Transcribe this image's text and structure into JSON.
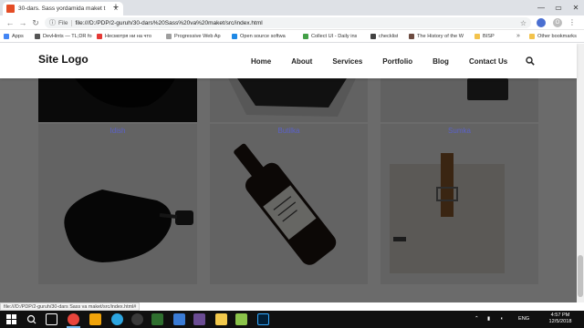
{
  "browser": {
    "tab_title": "30-dars. Sass yordamida maket t",
    "url_scheme_label": "File",
    "url": "file:///D:/PDP/2-guruh/30-dars%20Sass%20va%20maket/src/index.html",
    "status_url": "file:///D:/PDP/2-guruh/30-dars Sass va maket/src/index.html#",
    "profile_initial": "O"
  },
  "bookmarks": [
    {
      "label": "Apps",
      "color": "#4285f4"
    },
    {
      "label": "DevHints — TL;DR fo",
      "color": "#555555"
    },
    {
      "label": "Несмотря ни на что",
      "color": "#e53935"
    },
    {
      "label": "Progressive Web Ap",
      "color": "#9e9e9e"
    },
    {
      "label": "Open source softwa",
      "color": "#1e88e5"
    },
    {
      "label": "Collect UI - Daily ins",
      "color": "#43a047"
    },
    {
      "label": "checklist",
      "color": "#424242"
    },
    {
      "label": "The History of the W",
      "color": "#6d4c41"
    },
    {
      "label": "BISP",
      "color": "#f3c34c"
    }
  ],
  "bookmarks_other": "Other bookmarks",
  "site": {
    "logo": "Site Logo",
    "nav": [
      "Home",
      "About",
      "Services",
      "Portfolio",
      "Blog",
      "Contact Us"
    ]
  },
  "portfolio": {
    "captions": [
      "Idish",
      "Butilka",
      "Sumka"
    ]
  },
  "taskbar": {
    "lang": "ENG",
    "time": "4:57 PM",
    "date": "12/5/2018"
  },
  "colors": {
    "caption": "#5b62c8",
    "overlay": "rgba(0,0,0,0.58)"
  }
}
